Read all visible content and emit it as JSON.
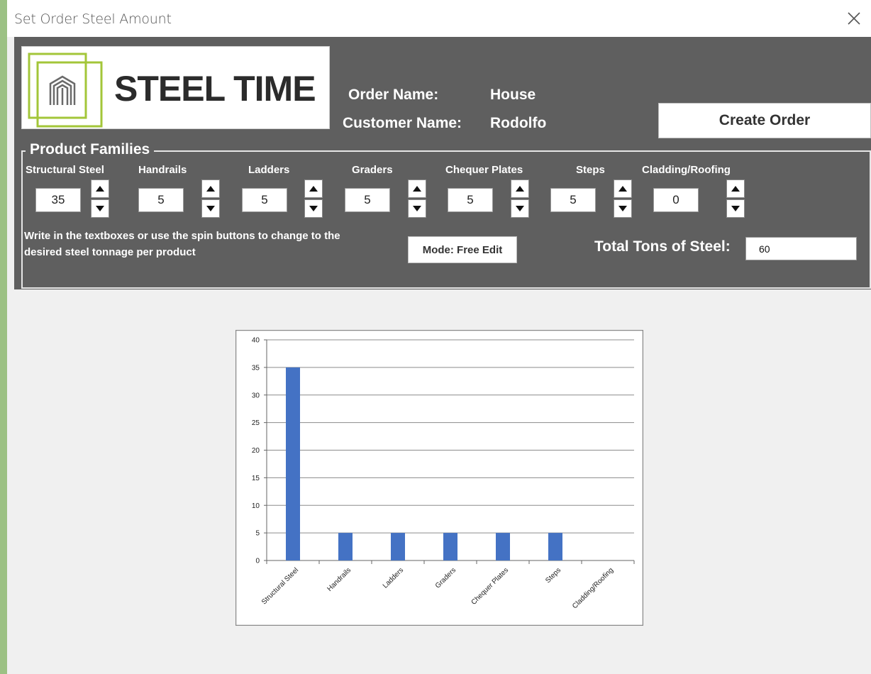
{
  "window": {
    "title": "Set Order Steel Amount"
  },
  "logo": {
    "text": "STEEL TIME"
  },
  "order_info": {
    "order_name_label": "Order Name:",
    "order_name_value": "House",
    "customer_name_label": "Customer Name:",
    "customer_name_value": "Rodolfo"
  },
  "buttons": {
    "create_order": "Create Order",
    "mode": "Mode: Free Edit"
  },
  "families": {
    "title": "Product Families",
    "items": [
      {
        "label": "Structural Steel",
        "value": "35"
      },
      {
        "label": "Handrails",
        "value": "5"
      },
      {
        "label": "Ladders",
        "value": "5"
      },
      {
        "label": "Graders",
        "value": "5"
      },
      {
        "label": "Chequer Plates",
        "value": "5"
      },
      {
        "label": "Steps",
        "value": "5"
      },
      {
        "label": "Cladding/Roofing",
        "value": "0"
      }
    ],
    "hint": "Write in the textboxes or use the spin buttons to change to the desired steel tonnage per product"
  },
  "total": {
    "label": "Total Tons of Steel:",
    "value": "60"
  },
  "colors": {
    "panel": "#5f5f5f",
    "bar": "#4472c4",
    "logo_accent": "#a3c639"
  },
  "chart_data": {
    "type": "bar",
    "categories": [
      "Structural Steel",
      "Handrails",
      "Ladders",
      "Graders",
      "Chequer Plates",
      "Steps",
      "Cladding/Roofing"
    ],
    "values": [
      35,
      5,
      5,
      5,
      5,
      5,
      0
    ],
    "ylim": [
      0,
      40
    ],
    "yticks": [
      0,
      5,
      10,
      15,
      20,
      25,
      30,
      35,
      40
    ],
    "grid": true,
    "legend": "none"
  }
}
